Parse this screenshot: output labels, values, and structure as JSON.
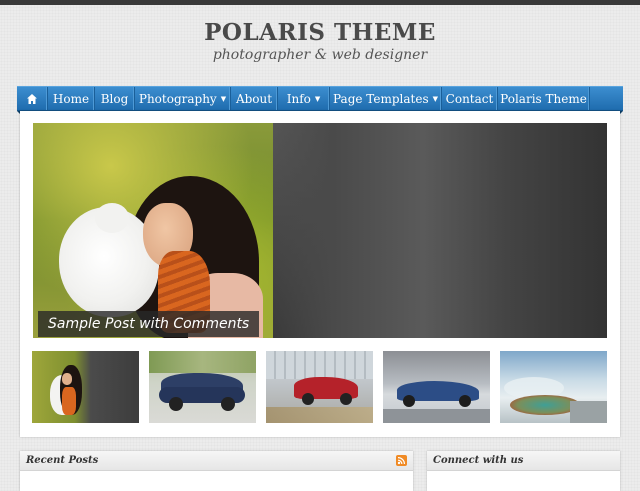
{
  "site": {
    "title": "POLARIS THEME",
    "tagline": "photographer & web designer"
  },
  "nav": {
    "home_icon": "home-icon",
    "items": [
      {
        "label": "Home",
        "dropdown": false
      },
      {
        "label": "Blog",
        "dropdown": false
      },
      {
        "label": "Photography",
        "dropdown": true
      },
      {
        "label": "About",
        "dropdown": false
      },
      {
        "label": "Info",
        "dropdown": true
      },
      {
        "label": "Page Templates",
        "dropdown": true
      },
      {
        "label": "Contact",
        "dropdown": false
      },
      {
        "label": "Polaris Theme",
        "dropdown": false
      }
    ],
    "caret": "▼"
  },
  "slider": {
    "caption": "Sample Post with Comments"
  },
  "thumbnails": [
    "woman-with-teddy-bear",
    "blue-sports-car",
    "red-car",
    "blue-coupe",
    "hot-spring-landscape"
  ],
  "sidebar_widgets": {
    "recent_posts": {
      "title": "Recent Posts",
      "icon": "rss-icon"
    },
    "connect": {
      "title": "Connect with us"
    }
  },
  "colors": {
    "nav_accent": "#2a7cc0",
    "rss": "#f08a24"
  }
}
